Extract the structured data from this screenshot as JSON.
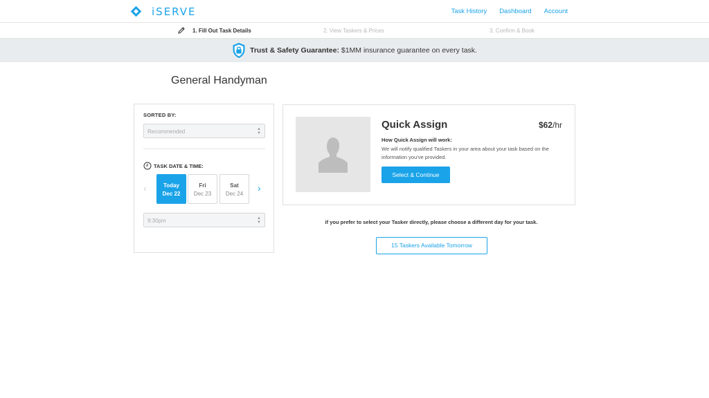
{
  "brand": {
    "name": "iSERVE",
    "logo_icon": "diamond-logo-icon",
    "accent": "#1aa3e8"
  },
  "nav": {
    "links": [
      "Task History",
      "Dashboard",
      "Account"
    ]
  },
  "steps": [
    {
      "label": "1. Fill Out Task Details",
      "state": "active",
      "icon": "pencil-icon"
    },
    {
      "label": "2. View Taskers & Prices",
      "state": "inactive"
    },
    {
      "label": "3. Confirm & Book",
      "state": "inactive"
    }
  ],
  "banner": {
    "icon": "shield-lock-icon",
    "bold": "Trust & Safety Guarantee:",
    "text": " $1MM insurance guarantee on every task."
  },
  "page_title": "General Handyman",
  "filter": {
    "sorted_by_label": "SORTED BY:",
    "sort_value": "Recommended",
    "date_time_label": "TASK DATE & TIME:",
    "days": [
      {
        "name": "Today",
        "date": "Dec 22",
        "selected": true
      },
      {
        "name": "Fri",
        "date": "Dec 23",
        "selected": false
      },
      {
        "name": "Sat",
        "date": "Dec 24",
        "selected": false
      }
    ],
    "time_value": "9:30pm"
  },
  "quick_assign": {
    "title": "Quick Assign",
    "price": "$62",
    "price_unit": "/hr",
    "how_title": "How Quick Assign will work:",
    "description": "We will notify qualified Taskers in your area about your task based on the information you've provided.",
    "button": "Select & Continue"
  },
  "hint": "if you prefer to select your  Tasker directly, please choose a different day for your task.",
  "available_button": "15 Taskers Available Tomorrow"
}
